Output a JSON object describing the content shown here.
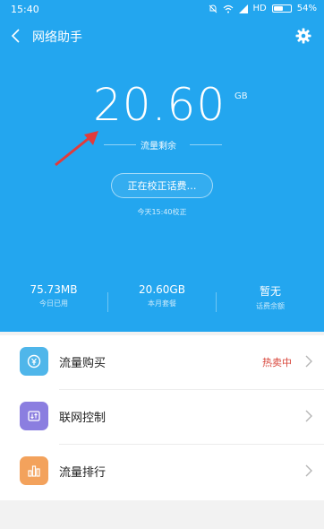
{
  "status_bar": {
    "time": "15:40",
    "network": "HD",
    "battery_percent": "54%",
    "battery_level": 0.54
  },
  "app": {
    "title": "网络助手"
  },
  "hero": {
    "remaining_value": "20.60",
    "remaining_unit": "GB",
    "remaining_label": "流量剩余",
    "calibrate_button": "正在校正话费…",
    "calibrated_at": "今天15:40校正"
  },
  "stats": [
    {
      "value": "75.73MB",
      "label": "今日已用"
    },
    {
      "value": "20.60GB",
      "label": "本月套餐"
    },
    {
      "value": "暂无",
      "label": "话费余额"
    }
  ],
  "menu": [
    {
      "label": "流量购买",
      "badge": "热卖中",
      "icon": "coin-icon",
      "color": "#4fb6ea"
    },
    {
      "label": "联网控制",
      "badge": "",
      "icon": "network-control-icon",
      "color": "#8b7ee0"
    },
    {
      "label": "流量排行",
      "badge": "",
      "icon": "bar-chart-icon",
      "color": "#f3a25c"
    }
  ],
  "colors": {
    "hero_bg": "#23a6ef",
    "badge": "#d8453a"
  }
}
